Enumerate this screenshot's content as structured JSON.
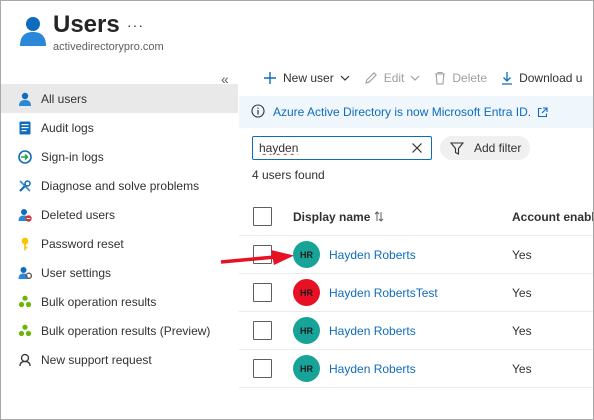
{
  "header": {
    "title": "Users",
    "subtitle": "activedirectorypro.com",
    "more": "···"
  },
  "sidebar": {
    "collapse": "«",
    "items": [
      {
        "label": "All users",
        "icon": "user-icon",
        "active": true
      },
      {
        "label": "Audit logs",
        "icon": "audit-log-icon"
      },
      {
        "label": "Sign-in logs",
        "icon": "sign-in-icon"
      },
      {
        "label": "Diagnose and solve problems",
        "icon": "wrench-icon"
      },
      {
        "label": "Deleted users",
        "icon": "deleted-user-icon"
      },
      {
        "label": "Password reset",
        "icon": "key-icon"
      },
      {
        "label": "User settings",
        "icon": "user-settings-icon"
      },
      {
        "label": "Bulk operation results",
        "icon": "bulk-operation-icon"
      },
      {
        "label": "Bulk operation results (Preview)",
        "icon": "bulk-operation-icon"
      },
      {
        "label": "New support request",
        "icon": "support-icon"
      }
    ]
  },
  "toolbar": {
    "new_user": "New user",
    "edit": "Edit",
    "delete": "Delete",
    "download": "Download u"
  },
  "banner": {
    "text": "Azure Active Directory is now Microsoft Entra ID."
  },
  "search": {
    "value": "hayden"
  },
  "filter": {
    "label": "Add filter"
  },
  "results": {
    "count_text": "4 users found"
  },
  "table": {
    "headers": {
      "name": "Display name",
      "account": "Account enable"
    },
    "rows": [
      {
        "initials": "HR",
        "name": "Hayden Roberts",
        "account_enabled": "Yes",
        "avatar_color": "#17a398"
      },
      {
        "initials": "HR",
        "name": "Hayden RobertsTest",
        "account_enabled": "Yes",
        "avatar_color": "#e81123"
      },
      {
        "initials": "HR",
        "name": "Hayden Roberts",
        "account_enabled": "Yes",
        "avatar_color": "#17a398"
      },
      {
        "initials": "HR",
        "name": "Hayden Roberts",
        "account_enabled": "Yes",
        "avatar_color": "#17a398"
      }
    ]
  },
  "colors": {
    "link": "#0f6cbd",
    "banner_bg": "#eff6fc",
    "active_nav_bg": "#e9e9e9",
    "annotation_arrow": "#e81123"
  }
}
